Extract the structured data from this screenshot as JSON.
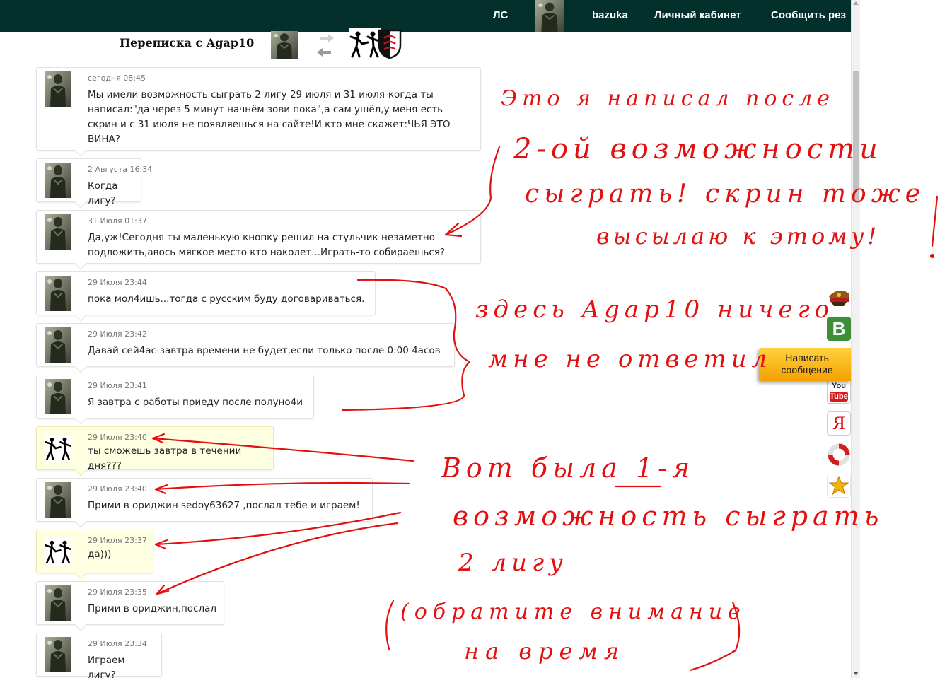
{
  "nav": {
    "ls": "ЛС",
    "user": "bazuka",
    "cabinet": "Личный кабинет",
    "report": "Сообщить рез"
  },
  "conversation": {
    "title": "Переписка с Agap10"
  },
  "messages": [
    {
      "time": "сегодня 08:45",
      "text": "Мы имели возможность сыграть 2 лигу 29 июля и 31 июля-когда ты написал:\"да через 5 минут начнём зови пока\",а сам ушёл,у меня есть скрин и с 31 июля не появляешься на сайте!И кто мне скажет:ЧЬЯ ЭТО ВИНА?"
    },
    {
      "time": "2 Августа 16:34",
      "text": "Когда лигу?"
    },
    {
      "time": "31 Июля 01:37",
      "text": "Да,уж!Сегодня ты маленькую кнопку решил на стульчик незаметно подложить,авось мягкое место кто наколет...Играть-то собираешься?"
    },
    {
      "time": "29 Июля 23:44",
      "text": "пока мол4ишь...тогда с русским буду договариваться."
    },
    {
      "time": "29 Июля 23:42",
      "text": "Давай сей4ас-завтра времени не будет,если только после 0:00 4асов"
    },
    {
      "time": "29 Июля 23:41",
      "text": "Я завтра с работы приеду после полуно4и"
    },
    {
      "time": "29 Июля 23:40",
      "text": "ты сможешь завтра в течении дня???"
    },
    {
      "time": "29 Июля 23:40",
      "text": "Прими в ориджин sedoy63627 ,послал тебе и играем!"
    },
    {
      "time": "29 Июля 23:37",
      "text": "да)))"
    },
    {
      "time": "29 Июля 23:35",
      "text": "Прими в ориджин,послал"
    },
    {
      "time": "29 Июля 23:34",
      "text": "Играем лигу?"
    }
  ],
  "sidebar": {
    "write_label": "Написать сообщение",
    "vk_letter": "B",
    "yandex_letter": "Я",
    "youtube_top": "You",
    "youtube_bottom": "Tube"
  },
  "annotations": {
    "note1_line1": "Это я написал после",
    "note1_line2": "2-ой возможности",
    "note1_line3": "сыграть! скрин тоже",
    "note1_line4": "высылаю к этому!",
    "note2_line1": "здесь Agap10 ничего",
    "note2_line2": "мне не ответил",
    "note3_line1": "Вот была 1-я",
    "note3_line2": "возможность сыграть",
    "note3_line3": "2 лигу",
    "note3_line4": "(обратите внимание",
    "note3_line5": "на время"
  },
  "colors": {
    "topbar": "#04302b",
    "annotation": "#e31010",
    "own_message_bg": "#ffffe1",
    "write_button": "#f5a000"
  },
  "icons": [
    "soldier-avatar-icon",
    "fighters-icon",
    "club-crest-icon",
    "swap-arrows-icon",
    "military-cap-icon",
    "vk-icon",
    "twitter-icon",
    "youtube-icon",
    "yandex-icon",
    "lifebuoy-icon",
    "star-icon"
  ]
}
